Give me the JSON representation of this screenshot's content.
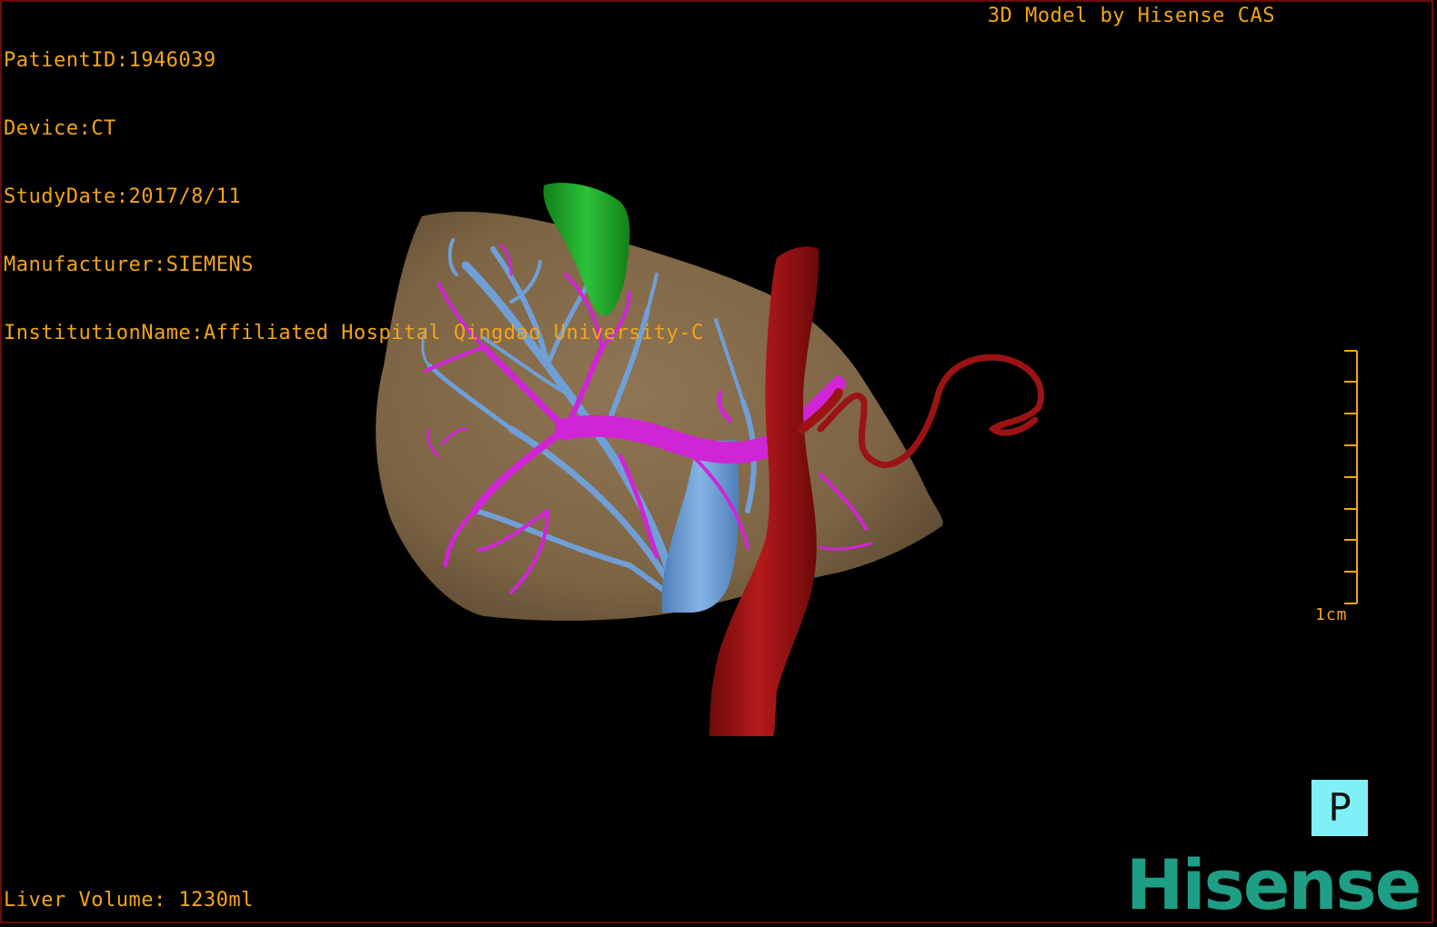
{
  "info": {
    "patient_id": "PatientID:1946039",
    "device": "Device:CT",
    "study_date": "StudyDate:2017/8/11",
    "manufacturer": "Manufacturer:SIEMENS",
    "institution": "InstitutionName:Affiliated Hospital Qingdao University-C"
  },
  "brand_caption": "3D Model by Hisense CAS",
  "liver_volume": "Liver Volume: 1230ml",
  "scale_bar": {
    "label": "1cm",
    "ticks": 9
  },
  "orientation_marker": "P",
  "logo_text": "Hisense",
  "colors": {
    "overlay_text": "#f2a51a",
    "liver": "#8c7150",
    "hepatic_vein": "#6f9fd6",
    "portal_vein": "#d025d6",
    "artery": "#9c1313",
    "gallbladder": "#1fa02a",
    "orientation_bg": "#7ff0f6",
    "logo": "#1f9e86"
  },
  "structures": {
    "liver": "liver-surface",
    "gallbladder": "gallbladder",
    "portal_vein": "portal-vein",
    "hepatic_vein": "hepatic-vein",
    "aorta": "aorta",
    "hepatic_artery": "hepatic-artery"
  }
}
